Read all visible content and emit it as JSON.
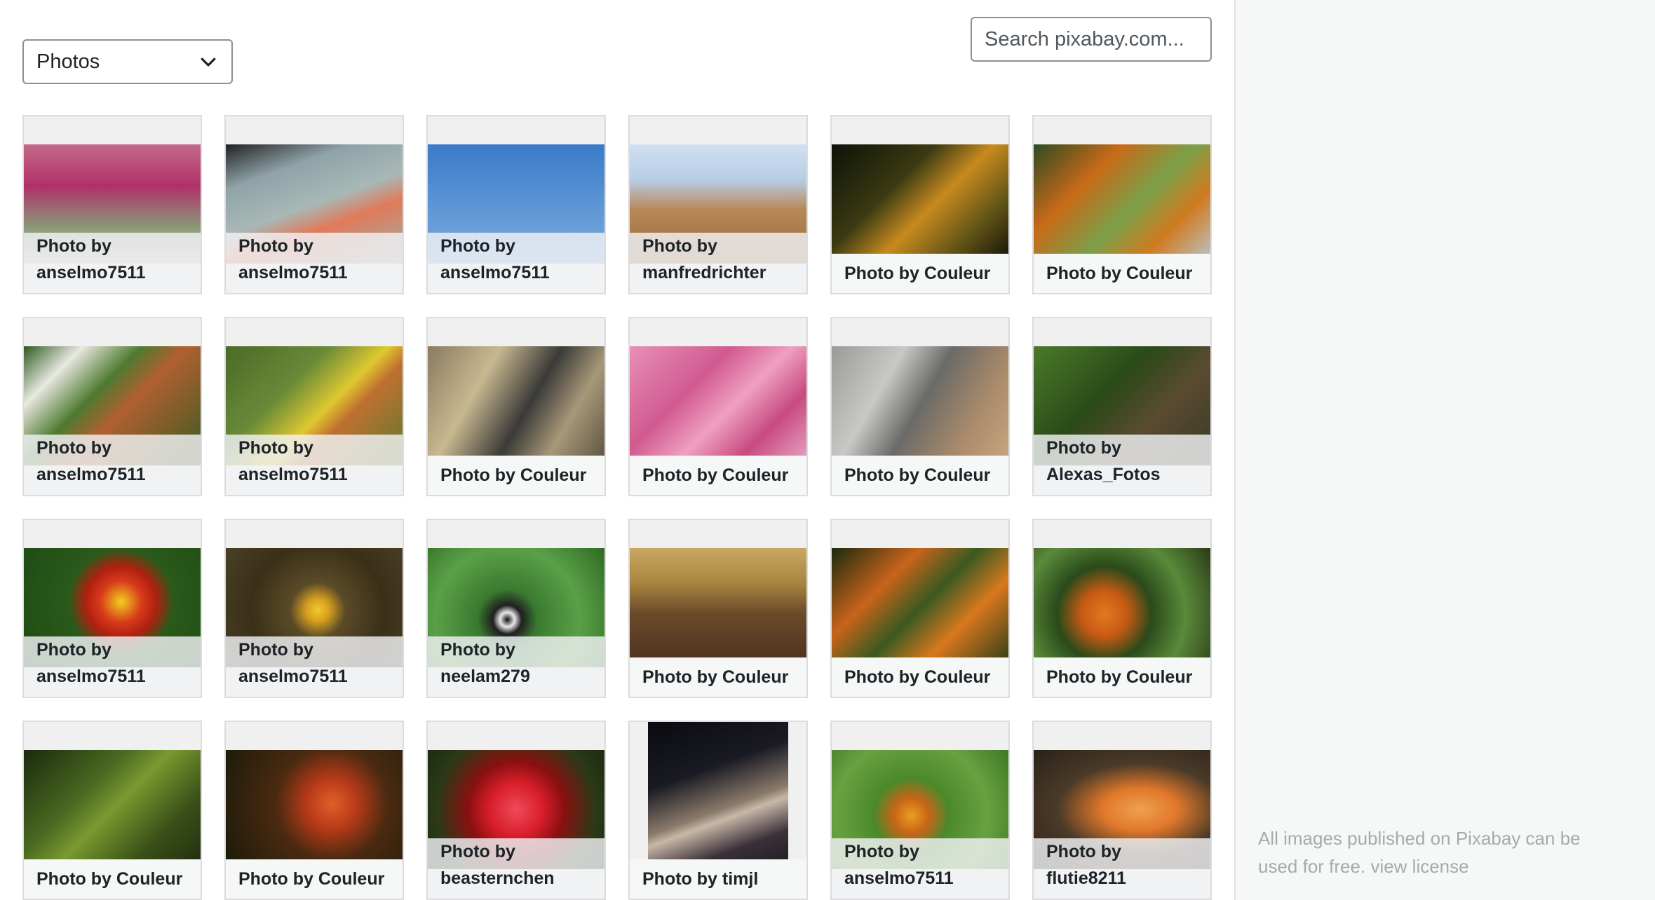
{
  "filter": {
    "selected": "Photos"
  },
  "search": {
    "placeholder": "Search pixabay.com..."
  },
  "photos": [
    {
      "line1": "Photo by",
      "line2": "anselmo7511",
      "bg": "linear-gradient(180deg,#c46a8a 0%,#b0306a 35%,#8a9a78 70%,#c9c0b8 100%)"
    },
    {
      "line1": "Photo by",
      "line2": "anselmo7511",
      "bg": "linear-gradient(160deg,#222 0%,#8fa3a8 25%,#a8b8b6 50%,#e07a5a 65%,#9fb0ae 100%)"
    },
    {
      "line1": "Photo by",
      "line2": "anselmo7511",
      "bg": "linear-gradient(180deg,#3a7ac8 0%,#5c95d6 50%,#7fa9dc 100%)"
    },
    {
      "line1": "Photo by",
      "line2": "manfredrichter",
      "bg": "linear-gradient(180deg,#cfe0f0 0%,#b7cde6 30%,#b88755 55%,#9a6a3e 100%)"
    },
    {
      "line1": "Photo by Couleur",
      "line2": "",
      "bg": "linear-gradient(135deg,#0e1208 0%,#3a3a12 35%,#c88a1e 55%,#6a5a18 75%,#101008 100%)"
    },
    {
      "line1": "Photo by Couleur",
      "line2": "",
      "bg": "linear-gradient(135deg,#2d4a22 0%,#c86a18 30%,#7aa048 55%,#d07a20 75%,#b8c8d0 100%)"
    },
    {
      "line1": "Photo by",
      "line2": "anselmo7511",
      "bg": "linear-gradient(135deg,#2e5a20 0%,#e8e8e0 20%,#4e7a30 40%,#b06030 55%,#3a5a22 100%)"
    },
    {
      "line1": "Photo by",
      "line2": "anselmo7511",
      "bg": "linear-gradient(135deg,#4a6a28 0%,#6a8a38 35%,#e0c830 55%,#c07030 65%,#5a7a30 100%)"
    },
    {
      "line1": "Photo by Couleur",
      "line2": "",
      "bg": "linear-gradient(120deg,#8a7a60 0%,#c8b890 30%,#3a3a38 55%,#a89878 75%,#5a5040 100%)"
    },
    {
      "line1": "Photo by Couleur",
      "line2": "",
      "bg": "linear-gradient(135deg,#e890b8 0%,#d05a90 35%,#f0a0c0 55%,#c84a80 75%,#e8a8c8 100%)"
    },
    {
      "line1": "Photo by Couleur",
      "line2": "",
      "bg": "linear-gradient(120deg,#9a9a98 0%,#c8c8c6 30%,#6a6a68 50%,#a88a6a 75%,#c8a880 100%)"
    },
    {
      "line1": "Photo by",
      "line2": "Alexas_Fotos",
      "bg": "linear-gradient(135deg,#4a7a2a 0%,#2a4a18 40%,#5a4a30 65%,#3a3a28 100%)"
    },
    {
      "line1": "Photo by",
      "line2": "anselmo7511",
      "bg": "radial-gradient(circle at 55% 45%,#f0d020 0%,#d83a1a 18%,#b02010 30%,#2a5a1a 45%,#1e4a14 100%)"
    },
    {
      "line1": "Photo by",
      "line2": "anselmo7511",
      "bg": "radial-gradient(circle at 52% 52%,#f0c830 0%,#d8a020 10%,#5a4a28 25%,#3a3018 60%,#4a4028 100%)"
    },
    {
      "line1": "Photo by",
      "line2": "neelam279",
      "bg": "radial-gradient(circle at 45% 60%,#101010 0%,#e8e8e8 6%,#202020 12%,#3a7a30 25%,#5aa048 60%,#2e6a24 100%)"
    },
    {
      "line1": "Photo by Couleur",
      "line2": "",
      "bg": "linear-gradient(180deg,#c8a860 0%,#a88440 30%,#6a4a28 55%,#4a3020 100%)"
    },
    {
      "line1": "Photo by Couleur",
      "line2": "",
      "bg": "linear-gradient(135deg,#1a2a10 0%,#c8641a 30%,#3a5a20 50%,#d8781e 70%,#283a18 100%)"
    },
    {
      "line1": "Photo by Couleur",
      "line2": "",
      "bg": "radial-gradient(circle at 40% 55%,#e07a20 0%,#c85a14 18%,#2a4a1a 38%,#5a8a3a 65%,#2a3a18 100%)"
    },
    {
      "line1": "Photo by Couleur",
      "line2": "",
      "bg": "linear-gradient(135deg,#1a2a0e 0%,#4a6a20 35%,#7a9a30 50%,#3a5018 75%,#202c10 100%)"
    },
    {
      "line1": "Photo by Couleur",
      "line2": "",
      "bg": "radial-gradient(circle at 60% 45%,#e0602a 0%,#b83a18 20%,#4a2a10 45%,#1a1a0a 100%)"
    },
    {
      "line1": "Photo by",
      "line2": "beasternchen",
      "bg": "radial-gradient(circle at 50% 50%,#f04a5a 0%,#d81e2a 25%,#8a1010 45%,#2a3a18 75%,#1e2a10 100%)"
    },
    {
      "line1": "Photo by timjl",
      "line2": "",
      "portrait": true,
      "bg": "linear-gradient(160deg,#0a0a10 0%,#1a1a24 30%,#8a7a6a 50%,#c8b8a8 55%,#3a3038 70%,#0a0a12 100%)"
    },
    {
      "line1": "Photo by",
      "line2": "anselmo7511",
      "bg": "radial-gradient(circle at 45% 55%,#e8a020 0%,#c86418 15%,#4a8a2a 32%,#6aa040 65%,#3a7a24 100%)"
    },
    {
      "line1": "Photo by",
      "line2": "flutie8211",
      "bg": "radial-gradient(ellipse at 60% 50%,#f0a050 0%,#e0782a 25%,#4a3a28 55%,#2a2218 100%)"
    }
  ],
  "notice": {
    "text": "All images published on Pixabay can be used for free.",
    "link": "view license"
  }
}
